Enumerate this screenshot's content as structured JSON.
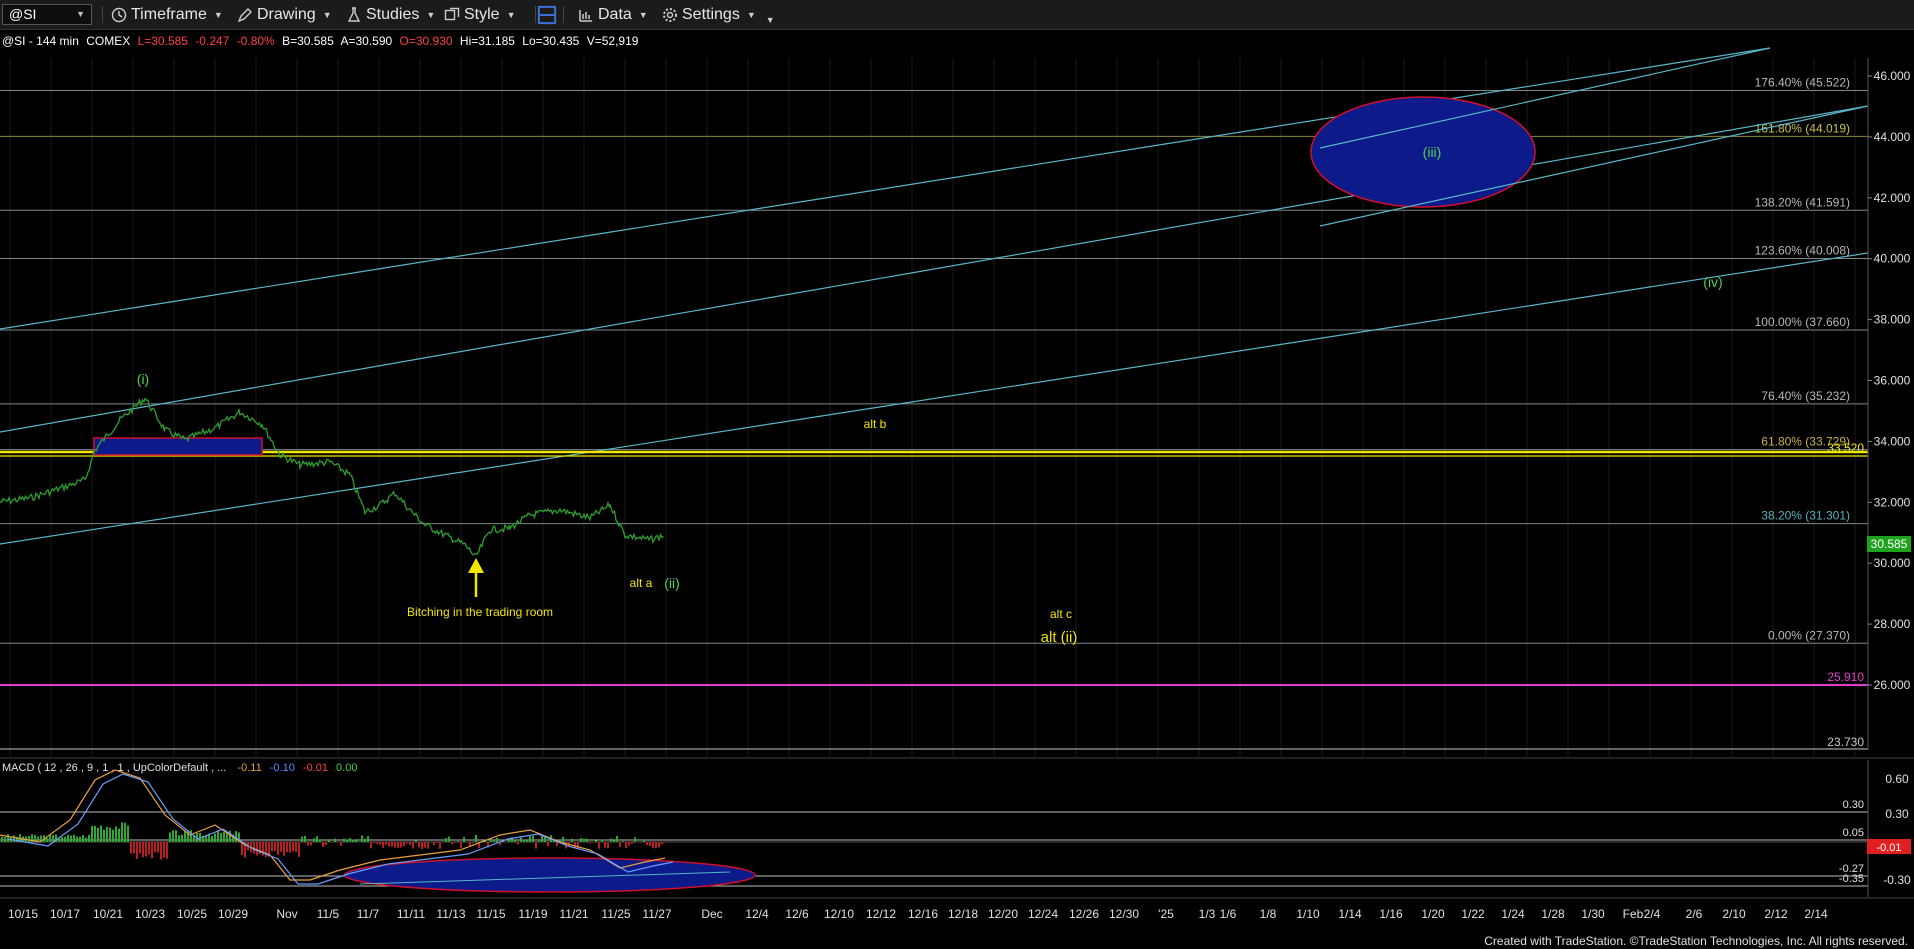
{
  "toolbar": {
    "symbol": "@SI",
    "timeframe": "Timeframe",
    "drawing": "Drawing",
    "studies": "Studies",
    "style": "Style",
    "data": "Data",
    "settings": "Settings"
  },
  "header": {
    "symbol": "@SI - 144 min",
    "exchange": "COMEX",
    "last": "L=30.585",
    "change": "-0.247",
    "pct": "-0.80%",
    "bid": "B=30.585",
    "ask": "A=30.590",
    "open": "O=30.930",
    "high": "Hi=31.185",
    "low": "Lo=30.435",
    "volume": "V=52,919"
  },
  "colors": {
    "background": "#000000",
    "price_bar": "#2e9e2e",
    "yellow": "#f2e600",
    "magenta": "#e040c8",
    "cyan_line": "#58b6c8",
    "ellipse_fill": "#0c1a8a",
    "ellipse_border": "#d0102a",
    "green_label": "#4fd24f",
    "neg_red": "#ff3030"
  },
  "price_axis": {
    "ticks": [
      "46.000",
      "44.000",
      "42.000",
      "40.000",
      "38.000",
      "36.000",
      "34.000",
      "32.000",
      "30.000",
      "28.000",
      "26.000"
    ],
    "last_price": "30.585",
    "yellow_level": "33.520",
    "magenta_level": "25.910",
    "bottom_level": "23.730"
  },
  "fib_levels": [
    {
      "label": "176.40% (45.522)",
      "price": 45.522
    },
    {
      "label": "161.80% (44.019)",
      "price": 44.019
    },
    {
      "label": "138.20% (41.591)",
      "price": 41.591
    },
    {
      "label": "123.60% (40.008)",
      "price": 40.008
    },
    {
      "label": "100.00% (37.660)",
      "price": 37.66
    },
    {
      "label": "76.40% (35.232)",
      "price": 35.232
    },
    {
      "label": "61.80% (33.729)",
      "price": 33.729
    },
    {
      "label": "38.20% (31.301)",
      "price": 31.301
    },
    {
      "label": "0.00% (27.370)",
      "price": 27.37
    }
  ],
  "annotations": {
    "wave_i": "(i)",
    "wave_ii": "(ii)",
    "wave_iii": "(iii)",
    "wave_iv": "(iv)",
    "alt_a": "alt a",
    "alt_b": "alt b",
    "alt_c": "alt c",
    "alt_ii": "alt (ii)",
    "note": "Bitching in the trading room"
  },
  "macd": {
    "title": "MACD ( 12 , 26 , 9 , 1 , 1 , UpColorDefault , ...",
    "v1": "-0.11",
    "v2": "-0.10",
    "v3": "-0.01",
    "v4": "0.00",
    "axis_ticks": [
      "0.60",
      "0.30"
    ],
    "levels": [
      "0.30",
      "0.05",
      "-0.27",
      "-0.35"
    ],
    "last_value": "-0.01"
  },
  "time_axis": [
    "10/15",
    "10/17",
    "10/21",
    "10/23",
    "10/25",
    "10/29",
    "Nov",
    "11/5",
    "11/7",
    "11/11",
    "11/13",
    "11/15",
    "11/19",
    "11/21",
    "11/25",
    "11/27",
    "Dec",
    "12/4",
    "12/6",
    "12/10",
    "12/12",
    "12/16",
    "12/18",
    "12/20",
    "12/24",
    "12/26",
    "12/30",
    "'25",
    "1/3",
    "1/6",
    "1/8",
    "1/10",
    "1/14",
    "1/16",
    "1/20",
    "1/22",
    "1/24",
    "1/28",
    "1/30",
    "Feb",
    "2/4",
    "2/6",
    "2/10",
    "2/12",
    "2/14"
  ],
  "footer": "Created with TradeStation. ©TradeStation Technologies, Inc. All rights reserved."
}
